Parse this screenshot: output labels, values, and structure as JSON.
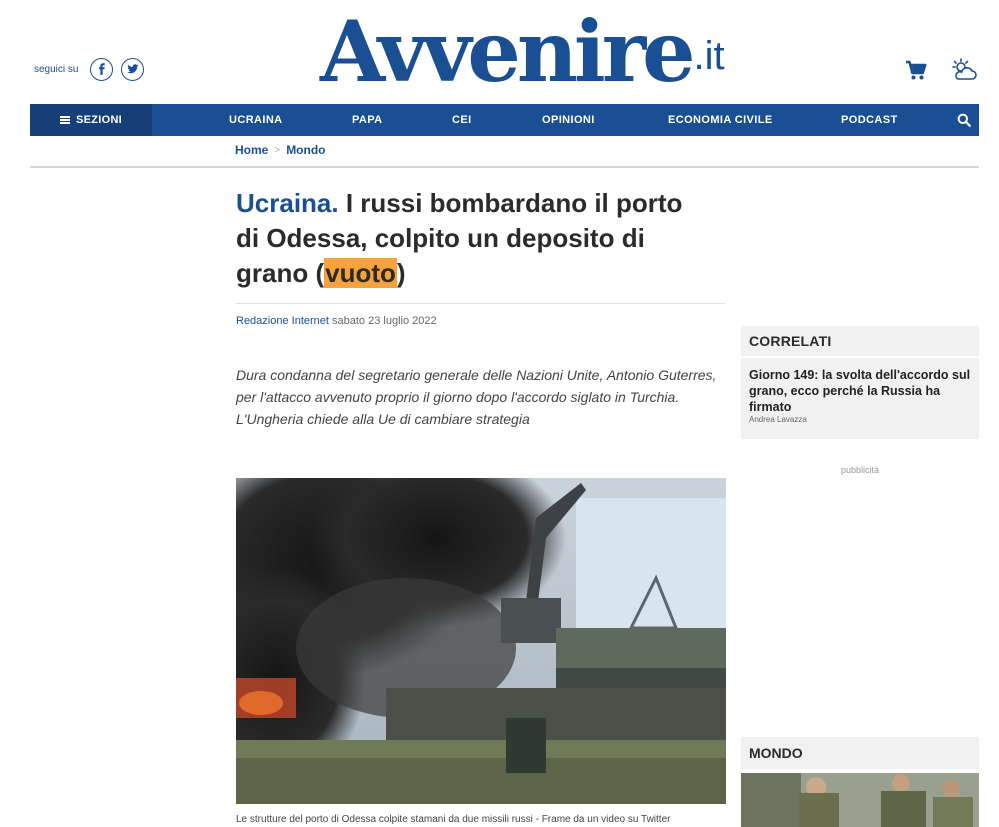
{
  "header": {
    "follow_label": "seguici su",
    "social": [
      "facebook-icon",
      "twitter-icon"
    ],
    "logo_main": "Avvenire",
    "logo_suffix": ".it",
    "icons": [
      "cart-icon",
      "weather-icon"
    ]
  },
  "nav": {
    "sections_label": "SEZIONI",
    "items": [
      "UCRAINA",
      "PAPA",
      "CEI",
      "OPINIONI",
      "ECONOMIA CIVILE",
      "PODCAST"
    ]
  },
  "breadcrumb": {
    "home": "Home",
    "separator": ">",
    "section": "Mondo"
  },
  "article": {
    "kicker": "Ucraina.",
    "title_main": " I russi bombardano il porto di Odessa, colpito un deposito di grano (",
    "title_highlight": "vuoto",
    "title_end": ")",
    "author": "Redazione Internet",
    "date": "sabato 23 luglio 2022",
    "summary": "Dura condanna del segretario generale delle Nazioni Unite, Antonio Guterres, per l'attacco avvenuto proprio il giorno dopo l'accordo siglato in Turchia. L'Ungheria chiede alla Ue di cambiare strategia",
    "caption": "Le strutture del porto di Odessa colpite stamani da due missili russi - Frame da un video su Twitter"
  },
  "sidebar": {
    "related_title": "CORRELATI",
    "related_link": "Giorno 149: la svolta dell'accordo sul grano, ecco perché la Russia ha firmato",
    "related_author": "Andrea Lavazza",
    "ads_label": "pubblicità",
    "mondo_title": "MONDO"
  },
  "colors": {
    "brand": "#1a4f94",
    "highlight": "#f7a23a"
  }
}
